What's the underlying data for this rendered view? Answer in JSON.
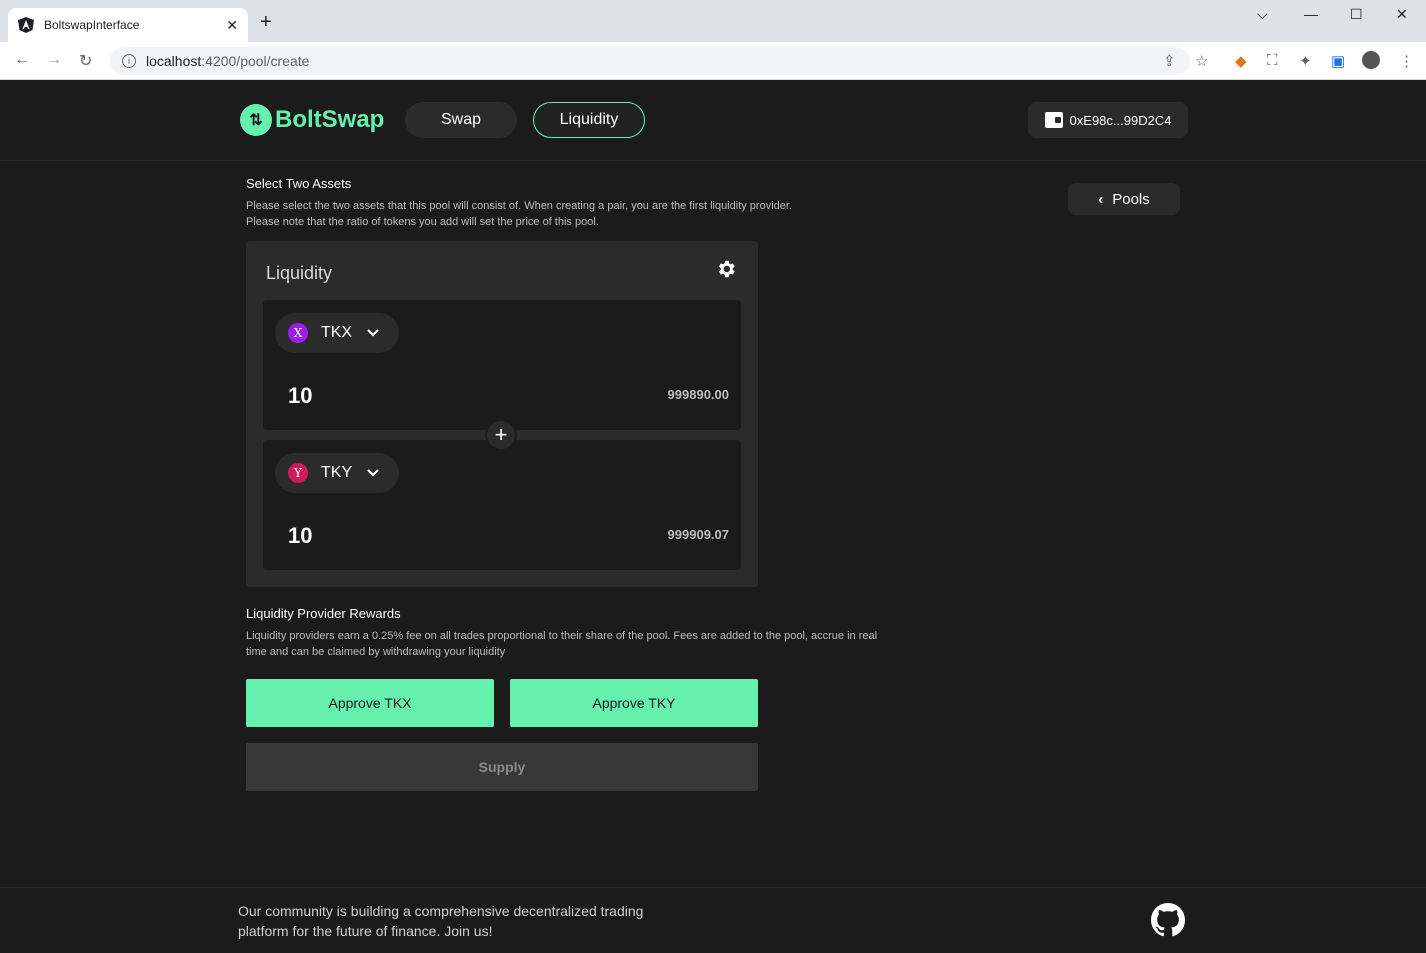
{
  "browser": {
    "tab_title": "BoltswapInterface",
    "url_host": "localhost",
    "url_path": ":4200/pool/create"
  },
  "header": {
    "logo_text": "BoltSwap",
    "nav": {
      "swap": "Swap",
      "liquidity": "Liquidity"
    },
    "wallet_address": "0xE98c...99D2C4"
  },
  "select_assets": {
    "title": "Select Two Assets",
    "desc_line1": "Please select the two assets that this pool will consist of. When creating a pair, you are the first liquidity provider.",
    "desc_line2": "Please note that the ratio of tokens you add will set the price of this pool."
  },
  "pools_button": "Pools",
  "card": {
    "title": "Liquidity",
    "assets": [
      {
        "icon_letter": "X",
        "icon_color": "#9b1fe8",
        "symbol": "TKX",
        "amount": "10",
        "balance": "999890.00"
      },
      {
        "icon_letter": "Y",
        "icon_color": "#d01a5c",
        "symbol": "TKY",
        "amount": "10",
        "balance": "999909.07"
      }
    ]
  },
  "rewards": {
    "title": "Liquidity Provider Rewards",
    "desc_line1": "Liquidity providers earn a 0.25% fee on all trades proportional to their share of the pool. Fees are added to the pool, accrue in real",
    "desc_line2": "time and can be claimed by withdrawing your liquidity"
  },
  "actions": {
    "approve_tkx": "Approve TKX",
    "approve_tky": "Approve TKY",
    "supply": "Supply"
  },
  "footer": {
    "text_line1": "Our community is building a comprehensive decentralized trading",
    "text_line2": "platform for the future of finance. Join us!"
  },
  "colors": {
    "accent": "#66f0ad",
    "background": "#1b1b1b",
    "panel": "#2b2b2b"
  }
}
